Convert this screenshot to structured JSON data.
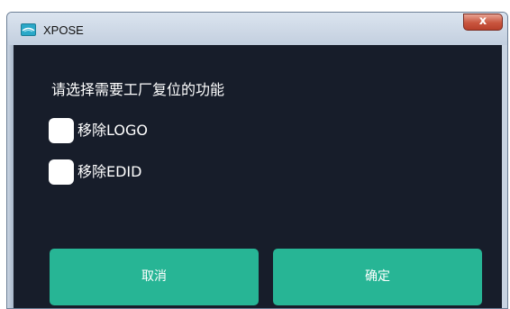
{
  "window": {
    "title": "XPOSE",
    "close_glyph": "x",
    "app_icon": "xpose-logo-icon"
  },
  "dialog": {
    "prompt": "请选择需要工厂复位的功能",
    "options": [
      {
        "label": "移除LOGO",
        "checked": false
      },
      {
        "label": "移除EDID",
        "checked": false
      }
    ],
    "cancel_label": "取消",
    "ok_label": "确定"
  },
  "colors": {
    "background": "#171d2a",
    "button": "#27b595",
    "text": "#ffffff",
    "close": "#c8553e"
  }
}
